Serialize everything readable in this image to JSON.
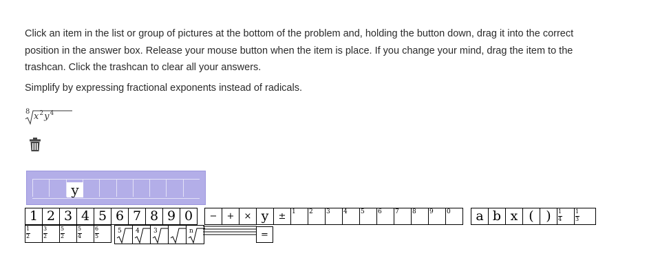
{
  "instructions": "Click an item in the list or group of pictures at the bottom of the problem and, holding the button down, drag it into the correct position in the answer box. Release your mouse button when the item is place. If you change your mind, drag the item to the trashcan. Click the trashcan to clear all your answers.",
  "prompt": "Simplify by expressing fractional exponents instead of radicals.",
  "expression": {
    "index": "8",
    "base1": "x",
    "exp1": "2",
    "base2": "y",
    "exp2": "4"
  },
  "trash_icon": "trash-icon",
  "answer": {
    "placed_tile": "y",
    "slot_count": 10
  },
  "palette_row1": [
    "1",
    "2",
    "3",
    "4",
    "5",
    "6",
    "7",
    "8",
    "9",
    "0",
    "−",
    "+",
    "×",
    "y",
    "±",
    "1",
    "2",
    "3",
    "4",
    "5",
    "6",
    "7",
    "8",
    "9",
    "0",
    "a",
    "b",
    "x",
    "(",
    ")"
  ],
  "palette_row1_fractions": [
    {
      "num": "1",
      "den": "4"
    },
    {
      "num": "1",
      "den": "3"
    }
  ],
  "palette_row2_fractions": [
    {
      "num": "1",
      "den": "2"
    },
    {
      "num": "3",
      "den": "2"
    },
    {
      "num": "5",
      "den": "2"
    },
    {
      "num": "5",
      "den": "4"
    },
    {
      "num": "6",
      "den": "5"
    }
  ],
  "palette_row2_radical_indices": [
    "5",
    "4",
    "3",
    "",
    "n"
  ],
  "palette_row2_equals": "="
}
